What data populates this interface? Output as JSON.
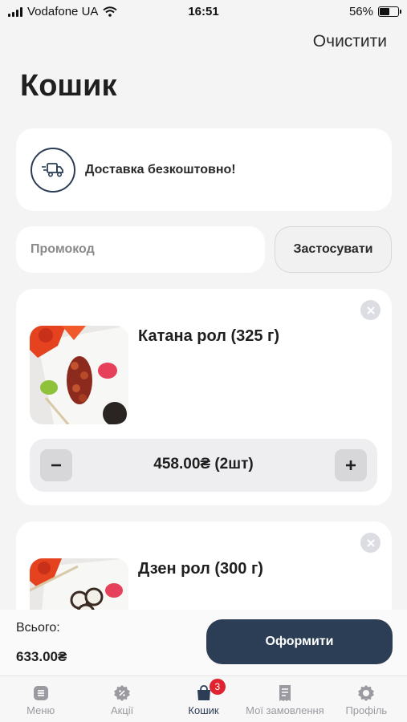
{
  "status_bar": {
    "carrier": "Vodafone UA",
    "time": "16:51",
    "battery": "56%",
    "battery_level": 0.56
  },
  "header": {
    "clear_label": "Очистити",
    "title": "Кошик"
  },
  "delivery": {
    "text": "Доставка безкоштовно!",
    "icon": "truck-icon"
  },
  "promo": {
    "placeholder": "Промокод",
    "value": "",
    "apply_label": "Застосувати"
  },
  "items": [
    {
      "name": "Катана рол (325 г)",
      "price_qty": "458.00₴  (2шт)"
    },
    {
      "name": "Дзен рол (300 г)"
    }
  ],
  "footer": {
    "total_label": "Всього:",
    "total_value": "633.00₴",
    "checkout_label": "Оформити"
  },
  "tabs": [
    {
      "label": "Меню",
      "icon": "menu-icon"
    },
    {
      "label": "Акції",
      "icon": "discount-icon"
    },
    {
      "label": "Кошик",
      "icon": "cart-icon",
      "badge": "3",
      "active": true
    },
    {
      "label": "Мої замовлення",
      "icon": "receipt-icon"
    },
    {
      "label": "Профіль",
      "icon": "profile-icon"
    }
  ],
  "colors": {
    "accent": "#2c3e55",
    "badge": "#e0242f",
    "background": "#f4f4f5"
  }
}
